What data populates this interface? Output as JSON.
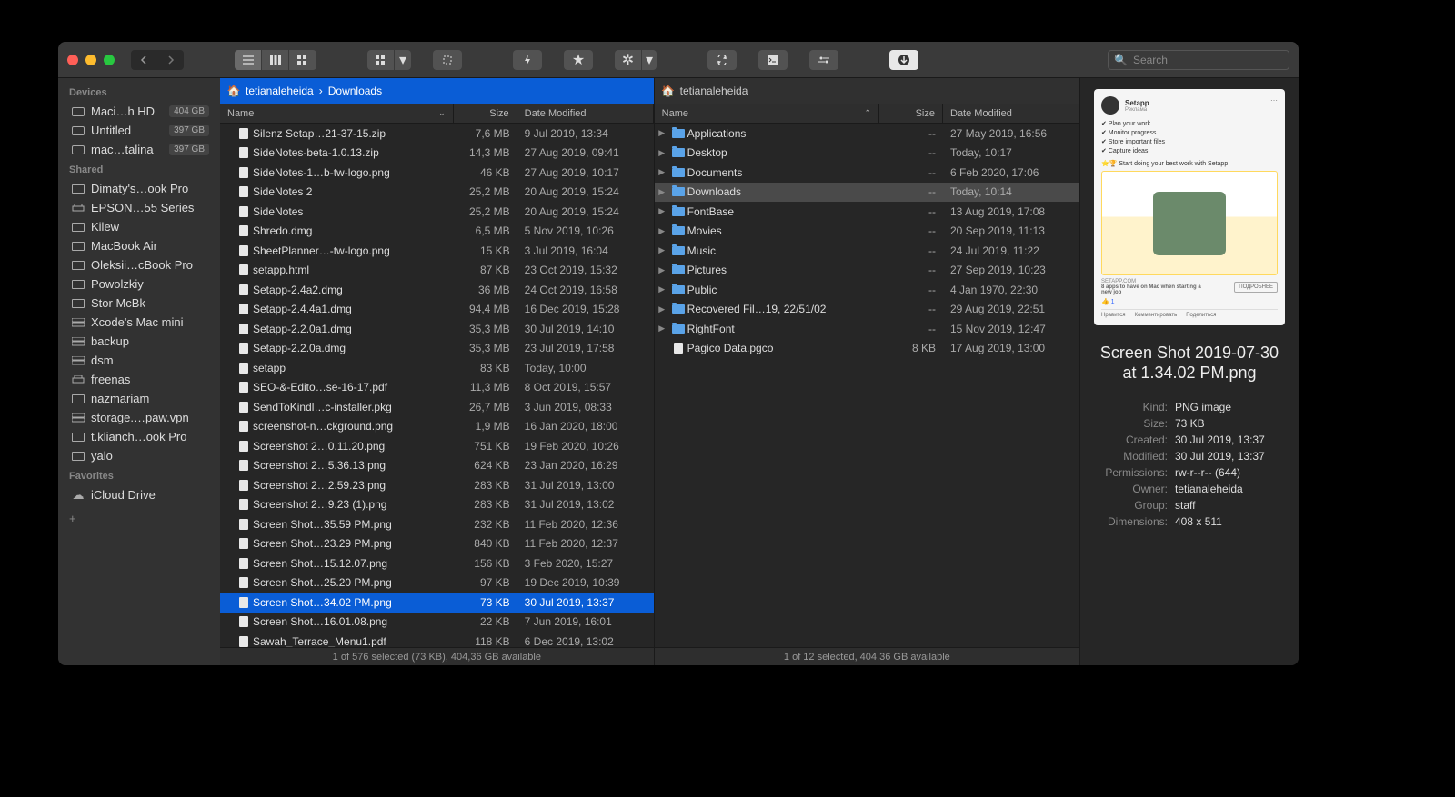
{
  "search_placeholder": "Search",
  "sidebar": {
    "sections": [
      {
        "title": "Devices",
        "items": [
          {
            "label": "Maci…h HD",
            "badge": "404 GB",
            "icon": "disk"
          },
          {
            "label": "Untitled",
            "badge": "397 GB",
            "icon": "disk"
          },
          {
            "label": "mac…talina",
            "badge": "397 GB",
            "icon": "disk"
          }
        ]
      },
      {
        "title": "Shared",
        "items": [
          {
            "label": "Dimaty's…ook Pro",
            "icon": "screen"
          },
          {
            "label": "EPSON…55 Series",
            "icon": "printer"
          },
          {
            "label": "Kilew",
            "icon": "screen"
          },
          {
            "label": "MacBook Air",
            "icon": "screen"
          },
          {
            "label": "Oleksii…cBook Pro",
            "icon": "screen"
          },
          {
            "label": "Powolzkiy",
            "icon": "screen"
          },
          {
            "label": "Stor McBk",
            "icon": "screen"
          },
          {
            "label": "Xcode's Mac mini",
            "icon": "server"
          },
          {
            "label": "backup",
            "icon": "server"
          },
          {
            "label": "dsm",
            "icon": "server"
          },
          {
            "label": "freenas",
            "icon": "printer"
          },
          {
            "label": "nazmariam",
            "icon": "screen"
          },
          {
            "label": "storage.…paw.vpn",
            "icon": "server"
          },
          {
            "label": "t.klianch…ook Pro",
            "icon": "screen"
          },
          {
            "label": "yalo",
            "icon": "screen"
          }
        ]
      },
      {
        "title": "Favorites",
        "items": [
          {
            "label": "iCloud Drive",
            "icon": "cloud"
          }
        ]
      }
    ]
  },
  "pane_left": {
    "path_parts": [
      "tetianaleheida",
      "Downloads"
    ],
    "columns": {
      "name": "Name",
      "size": "Size",
      "date": "Date Modified"
    },
    "status": "1 of 576 selected (73 KB), 404,36 GB available",
    "rows": [
      {
        "name": "Silenz Setap…21-37-15.zip",
        "size": "7,6 MB",
        "date": "9 Jul 2019, 13:34",
        "icon": "zip"
      },
      {
        "name": "SideNotes-beta-1.0.13.zip",
        "size": "14,3 MB",
        "date": "27 Aug 2019, 09:41",
        "icon": "zip"
      },
      {
        "name": "SideNotes-1…b-tw-logo.png",
        "size": "46 KB",
        "date": "27 Aug 2019, 10:17",
        "icon": "png"
      },
      {
        "name": "SideNotes 2",
        "size": "25,2 MB",
        "date": "20 Aug 2019, 15:24",
        "icon": "app"
      },
      {
        "name": "SideNotes",
        "size": "25,2 MB",
        "date": "20 Aug 2019, 15:24",
        "icon": "app"
      },
      {
        "name": "Shredo.dmg",
        "size": "6,5 MB",
        "date": "5 Nov 2019, 10:26",
        "icon": "doc"
      },
      {
        "name": "SheetPlanner…-tw-logo.png",
        "size": "15 KB",
        "date": "3 Jul 2019, 16:04",
        "icon": "png"
      },
      {
        "name": "setapp.html",
        "size": "87 KB",
        "date": "23 Oct 2019, 15:32",
        "icon": "doc"
      },
      {
        "name": "Setapp-2.4a2.dmg",
        "size": "36 MB",
        "date": "24 Oct 2019, 16:58",
        "icon": "doc"
      },
      {
        "name": "Setapp-2.4.4a1.dmg",
        "size": "94,4 MB",
        "date": "16 Dec 2019, 15:28",
        "icon": "doc"
      },
      {
        "name": "Setapp-2.2.0a1.dmg",
        "size": "35,3 MB",
        "date": "30 Jul 2019, 14:10",
        "icon": "doc"
      },
      {
        "name": "Setapp-2.2.0a.dmg",
        "size": "35,3 MB",
        "date": "23 Jul 2019, 17:58",
        "icon": "doc"
      },
      {
        "name": "setapp",
        "size": "83 KB",
        "date": "Today, 10:00",
        "icon": "doc"
      },
      {
        "name": "SEO-&-Edito…se-16-17.pdf",
        "size": "11,3 MB",
        "date": "8 Oct 2019, 15:57",
        "icon": "doc"
      },
      {
        "name": "SendToKindl…c-installer.pkg",
        "size": "26,7 MB",
        "date": "3 Jun 2019, 08:33",
        "icon": "pkg"
      },
      {
        "name": "screenshot-n…ckground.png",
        "size": "1,9 MB",
        "date": "16 Jan 2020, 18:00",
        "icon": "png"
      },
      {
        "name": "Screenshot 2…0.11.20.png",
        "size": "751 KB",
        "date": "19 Feb 2020, 10:26",
        "icon": "png"
      },
      {
        "name": "Screenshot 2…5.36.13.png",
        "size": "624 KB",
        "date": "23 Jan 2020, 16:29",
        "icon": "png"
      },
      {
        "name": "Screenshot 2…2.59.23.png",
        "size": "283 KB",
        "date": "31 Jul 2019, 13:00",
        "icon": "png"
      },
      {
        "name": "Screenshot 2…9.23 (1).png",
        "size": "283 KB",
        "date": "31 Jul 2019, 13:02",
        "icon": "png"
      },
      {
        "name": "Screen Shot…35.59 PM.png",
        "size": "232 KB",
        "date": "11 Feb 2020, 12:36",
        "icon": "png"
      },
      {
        "name": "Screen Shot…23.29 PM.png",
        "size": "840 KB",
        "date": "11 Feb 2020, 12:37",
        "icon": "png"
      },
      {
        "name": "Screen Shot…15.12.07.png",
        "size": "156 KB",
        "date": "3 Feb 2020, 15:27",
        "icon": "png"
      },
      {
        "name": "Screen Shot…25.20 PM.png",
        "size": "97 KB",
        "date": "19 Dec 2019, 10:39",
        "icon": "png"
      },
      {
        "name": "Screen Shot…34.02 PM.png",
        "size": "73 KB",
        "date": "30 Jul 2019, 13:37",
        "icon": "png",
        "selected": true
      },
      {
        "name": "Screen Shot…16.01.08.png",
        "size": "22 KB",
        "date": "7 Jun 2019, 16:01",
        "icon": "png"
      },
      {
        "name": "Sawah_Terrace_Menu1.pdf",
        "size": "118 KB",
        "date": "6 Dec 2019, 13:02",
        "icon": "doc"
      }
    ]
  },
  "pane_right": {
    "path_parts": [
      "tetianaleheida"
    ],
    "columns": {
      "name": "Name",
      "size": "Size",
      "date": "Date Modified"
    },
    "status": "1 of 12 selected, 404,36 GB available",
    "rows": [
      {
        "name": "Applications",
        "size": "--",
        "date": "27 May 2019, 16:56",
        "folder": true
      },
      {
        "name": "Desktop",
        "size": "--",
        "date": "Today, 10:17",
        "folder": true
      },
      {
        "name": "Documents",
        "size": "--",
        "date": "6 Feb 2020, 17:06",
        "folder": true
      },
      {
        "name": "Downloads",
        "size": "--",
        "date": "Today, 10:14",
        "folder": true,
        "selected": true
      },
      {
        "name": "FontBase",
        "size": "--",
        "date": "13 Aug 2019, 17:08",
        "folder": true
      },
      {
        "name": "Movies",
        "size": "--",
        "date": "20 Sep 2019, 11:13",
        "folder": true
      },
      {
        "name": "Music",
        "size": "--",
        "date": "24 Jul 2019, 11:22",
        "folder": true
      },
      {
        "name": "Pictures",
        "size": "--",
        "date": "27 Sep 2019, 10:23",
        "folder": true
      },
      {
        "name": "Public",
        "size": "--",
        "date": "4 Jan 1970, 22:30",
        "folder": true
      },
      {
        "name": "Recovered Fil…19, 22/51/02",
        "size": "--",
        "date": "29 Aug 2019, 22:51",
        "folder": true
      },
      {
        "name": "RightFont",
        "size": "--",
        "date": "15 Nov 2019, 12:47",
        "folder": true
      },
      {
        "name": "Pagico Data.pgco",
        "size": "8 KB",
        "date": "17 Aug 2019, 13:00",
        "folder": false
      }
    ]
  },
  "preview": {
    "title": "Screen Shot 2019-07-30 at 1.34.02 PM.png",
    "ad": {
      "brand": "Setapp",
      "sub": "Реклама",
      "bullets": [
        "✔ Plan your work",
        "✔ Monitor progress",
        "✔ Store important files",
        "✔ Capture ideas"
      ],
      "highlight": "⭐🏆 Start doing your best work with Setapp",
      "domain": "SETAPP.COM",
      "headline": "8 apps to have on Mac when starting a new job",
      "cta": "ПОДРОБНЕЕ",
      "likes": "1",
      "actions": [
        "Нравится",
        "Комментировать",
        "Поделиться"
      ]
    },
    "meta": [
      {
        "label": "Kind:",
        "value": "PNG image"
      },
      {
        "label": "Size:",
        "value": "73 KB"
      },
      {
        "label": "Created:",
        "value": "30 Jul 2019, 13:37"
      },
      {
        "label": "Modified:",
        "value": "30 Jul 2019, 13:37"
      },
      {
        "label": "Permissions:",
        "value": "rw-r--r-- (644)"
      },
      {
        "label": "Owner:",
        "value": "tetianaleheida"
      },
      {
        "label": "Group:",
        "value": "staff"
      },
      {
        "label": "Dimensions:",
        "value": "408 x 511"
      }
    ]
  }
}
